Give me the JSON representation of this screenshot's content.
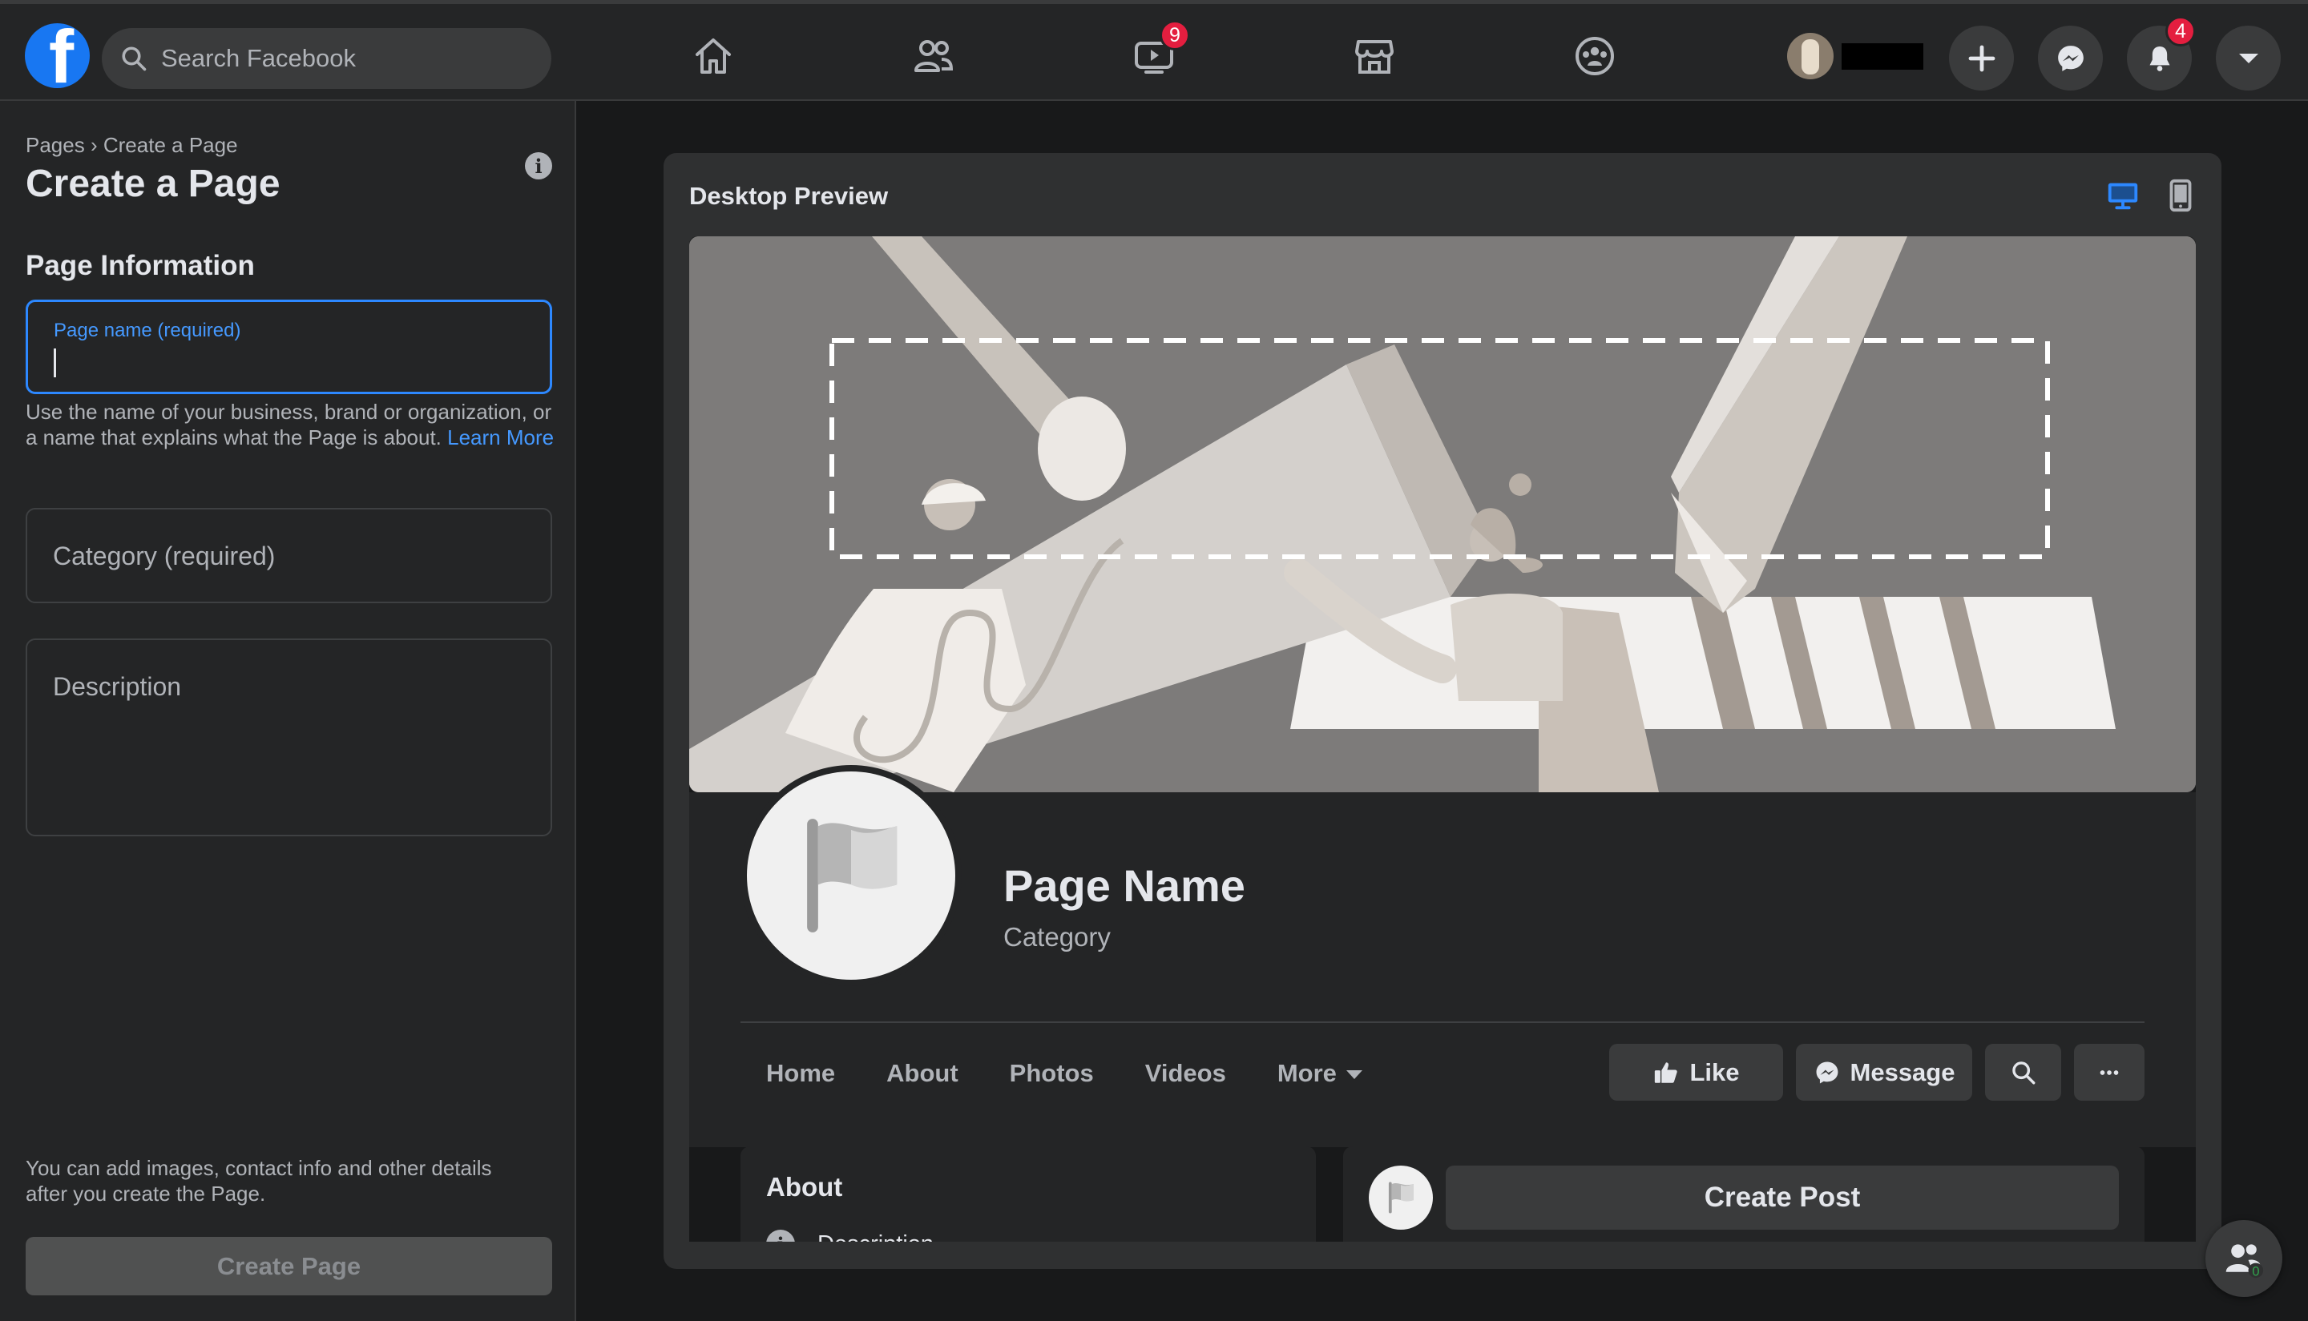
{
  "topbar": {
    "logo": "f",
    "search_placeholder": "Search Facebook",
    "nav_icons": [
      "home-icon",
      "friends-icon",
      "watch-icon",
      "marketplace-icon",
      "groups-icon"
    ],
    "watch_badge": "9",
    "notifications_badge": "4",
    "colors": {
      "accent": "#1877f2",
      "badge": "#e41e3f"
    }
  },
  "sidebar": {
    "breadcrumb_root": "Pages",
    "breadcrumb_sep": "›",
    "breadcrumb_current": "Create a Page",
    "title": "Create a Page",
    "section": "Page Information",
    "page_name_label": "Page name (required)",
    "page_name_value": "",
    "helper_text": "Use the name of your business, brand or organization, or a name that explains what the Page is about.",
    "helper_link": "Learn More",
    "category_placeholder": "Category (required)",
    "description_placeholder": "Description",
    "footer_note": "You can add images, contact info and other details after you create the Page.",
    "create_button": "Create Page"
  },
  "preview": {
    "title": "Desktop Preview",
    "active_view": "desktop",
    "page_name": "Page Name",
    "category": "Category",
    "tabs": [
      "Home",
      "About",
      "Photos",
      "Videos",
      "More"
    ],
    "like_label": "Like",
    "message_label": "Message",
    "about_title": "About",
    "about_description": "Description",
    "create_post_label": "Create Post"
  },
  "contacts_fab": {
    "count": "0"
  }
}
